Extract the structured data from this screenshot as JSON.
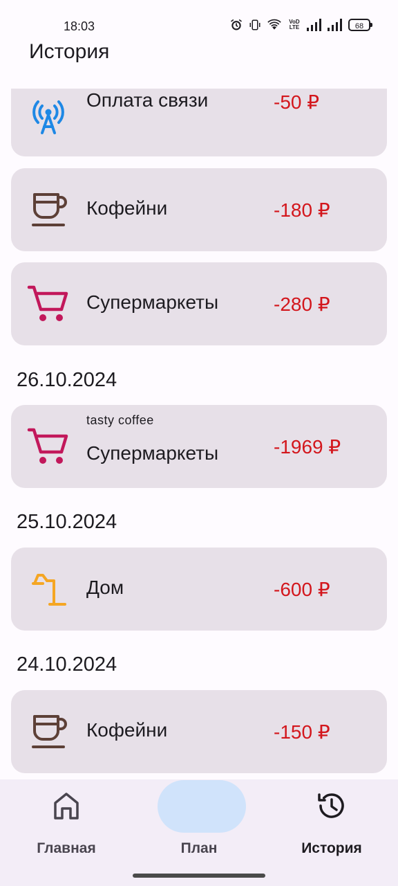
{
  "status_bar": {
    "time": "18:03",
    "volte": "VoD LTE",
    "battery": "68"
  },
  "header": {
    "title": "История"
  },
  "history": {
    "items": [
      {
        "icon": "antenna-icon",
        "name": "Оплата связи",
        "amount": "-50 ₽"
      },
      {
        "icon": "coffee-cup-icon",
        "name": "Кофейни",
        "amount": "-180 ₽"
      },
      {
        "icon": "cart-icon",
        "name": "Супермаркеты",
        "amount": "-280 ₽"
      }
    ],
    "groups": [
      {
        "date": "26.10.2024",
        "item": {
          "icon": "cart-icon",
          "note": "tasty coffee",
          "name": "Супермаркеты",
          "amount": "-1969 ₽"
        }
      },
      {
        "date": "25.10.2024",
        "item": {
          "icon": "desk-lamp-icon",
          "name": "Дом",
          "amount": "-600 ₽"
        }
      },
      {
        "date": "24.10.2024",
        "item": {
          "icon": "coffee-cup-icon",
          "name": "Кофейни",
          "amount": "-150 ₽"
        }
      }
    ]
  },
  "nav": {
    "items": [
      {
        "label": "Главная",
        "icon": "home-icon"
      },
      {
        "label": "План",
        "icon": "checklist-icon"
      },
      {
        "label": "История",
        "icon": "history-icon",
        "active": true
      }
    ]
  },
  "colors": {
    "card_bg": "#e7e0e8",
    "amount": "#d3161c",
    "antenna": "#1e88e5",
    "coffee": "#5d4037",
    "cart": "#c2185b",
    "lamp": "#f5a623",
    "nav_active_pill": "#d0e3fb"
  }
}
